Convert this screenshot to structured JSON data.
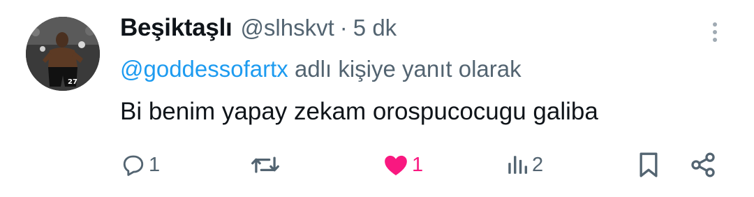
{
  "tweet": {
    "display_name": "Beşiktaşlı",
    "handle": "@slhskvt",
    "separator": "·",
    "time": "5 dk",
    "reply_to_mention": "@goddessofartx",
    "reply_to_suffix": " adlı kişiye yanıt olarak",
    "body": "Bi benim yapay zekam orospucocugu galiba",
    "avatar_icon": "profile-photo"
  },
  "actions": {
    "reply": {
      "icon": "reply-icon",
      "count": "1"
    },
    "repost": {
      "icon": "repost-icon",
      "count": ""
    },
    "like": {
      "icon": "heart-icon",
      "count": "1",
      "color": "#f91880",
      "liked": true
    },
    "views": {
      "icon": "views-icon",
      "count": "2"
    },
    "bookmark": {
      "icon": "bookmark-icon"
    },
    "share": {
      "icon": "share-icon"
    }
  },
  "colors": {
    "link": "#1d9bf0",
    "secondary_text": "#536471",
    "primary_text": "#0f1419",
    "like": "#f91880"
  }
}
